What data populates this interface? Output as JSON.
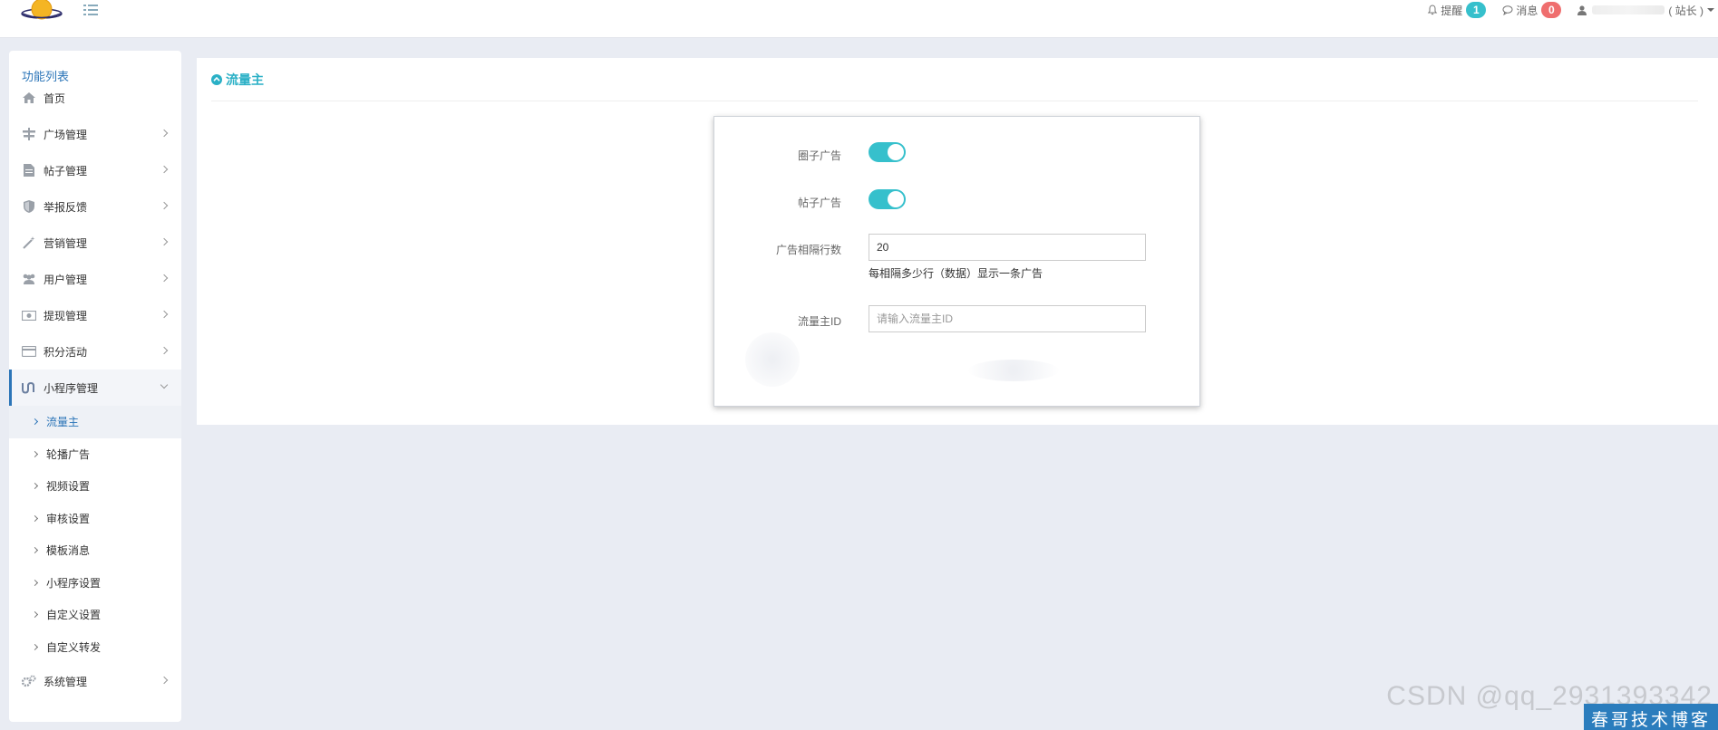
{
  "header": {
    "reminder_label": "提醒",
    "reminder_count": "1",
    "message_label": "消息",
    "message_count": "0",
    "user_role": "( 站长 )",
    "colors": {
      "reminder_badge": "#36c0cc",
      "message_badge": "#ef6e6e"
    }
  },
  "sidebar": {
    "title": "功能列表",
    "items": [
      {
        "label": "首页",
        "icon": "home-icon"
      },
      {
        "label": "广场管理",
        "icon": "signpost-icon"
      },
      {
        "label": "帖子管理",
        "icon": "document-icon"
      },
      {
        "label": "举报反馈",
        "icon": "shield-icon"
      },
      {
        "label": "营销管理",
        "icon": "magic-wand-icon"
      },
      {
        "label": "用户管理",
        "icon": "users-icon"
      },
      {
        "label": "提现管理",
        "icon": "money-icon"
      },
      {
        "label": "积分活动",
        "icon": "credit-card-icon"
      },
      {
        "label": "小程序管理",
        "icon": "mini-program-icon"
      }
    ],
    "sub_items": [
      {
        "label": "流量主"
      },
      {
        "label": "轮播广告"
      },
      {
        "label": "视频设置"
      },
      {
        "label": "审核设置"
      },
      {
        "label": "模板消息"
      },
      {
        "label": "小程序设置"
      },
      {
        "label": "自定义设置"
      },
      {
        "label": "自定义转发"
      }
    ],
    "system": {
      "label": "系统管理",
      "icon": "gears-icon"
    }
  },
  "main": {
    "title": "流量主",
    "form": {
      "circle_ad_label": "圈子广告",
      "circle_ad_on": true,
      "post_ad_label": "帖子广告",
      "post_ad_on": true,
      "interval_label": "广告相隔行数",
      "interval_value": "20",
      "interval_help": "每相隔多少行（数据）显示一条广告",
      "traffic_id_label": "流量主ID",
      "traffic_id_placeholder": "请输入流量主ID",
      "traffic_id_value": ""
    }
  },
  "watermark": {
    "csdn": "CSDN @qq_2931393342",
    "blog": "春哥技术博客"
  }
}
